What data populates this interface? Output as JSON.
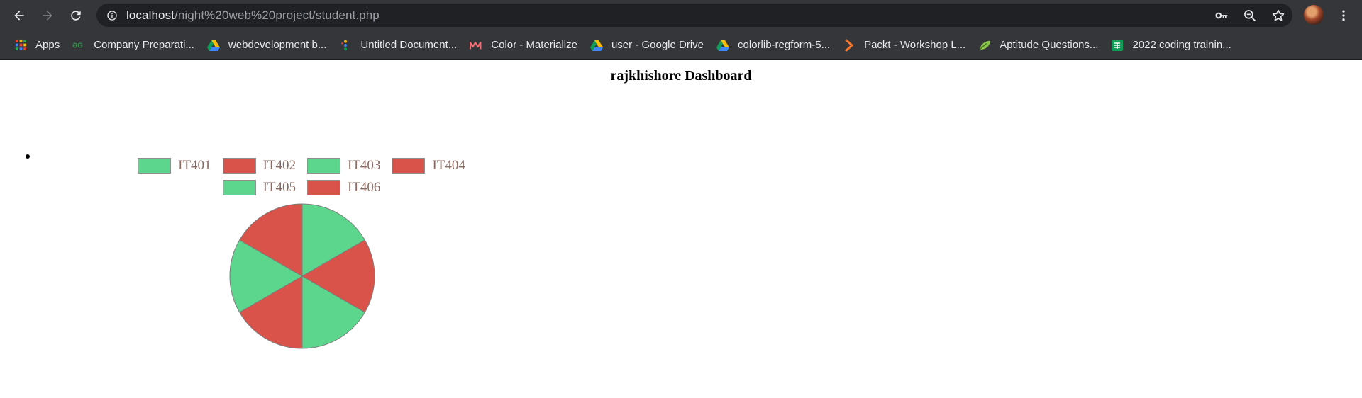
{
  "browser": {
    "url_host": "localhost",
    "url_path": "/night%20web%20project/student.php"
  },
  "bookmarks": [
    {
      "label": "Apps",
      "icon": "apps-grid-icon"
    },
    {
      "label": "Company Preparati...",
      "icon": "geeksforgeeks-icon"
    },
    {
      "label": "webdevelopment b...",
      "icon": "google-drive-icon"
    },
    {
      "label": "Untitled Document...",
      "icon": "document-icon"
    },
    {
      "label": "Color - Materialize",
      "icon": "materialize-icon"
    },
    {
      "label": "user - Google Drive",
      "icon": "google-drive-icon"
    },
    {
      "label": "colorlib-regform-5...",
      "icon": "google-drive-icon"
    },
    {
      "label": "Packt - Workshop L...",
      "icon": "packt-icon"
    },
    {
      "label": "Aptitude Questions...",
      "icon": "leaf-icon"
    },
    {
      "label": "2022 coding trainin...",
      "icon": "google-sheets-icon"
    }
  ],
  "page": {
    "title": "rajkhishore Dashboard"
  },
  "colors": {
    "green": "#5cd68c",
    "red": "#d9534a"
  },
  "chart_data": {
    "type": "pie",
    "categories": [
      "IT401",
      "IT402",
      "IT403",
      "IT404",
      "IT405",
      "IT406"
    ],
    "values": [
      1,
      1,
      1,
      1,
      1,
      1
    ],
    "colors": [
      "#5cd68c",
      "#d9534a",
      "#5cd68c",
      "#d9534a",
      "#5cd68c",
      "#d9534a"
    ],
    "legend_position": "top"
  }
}
